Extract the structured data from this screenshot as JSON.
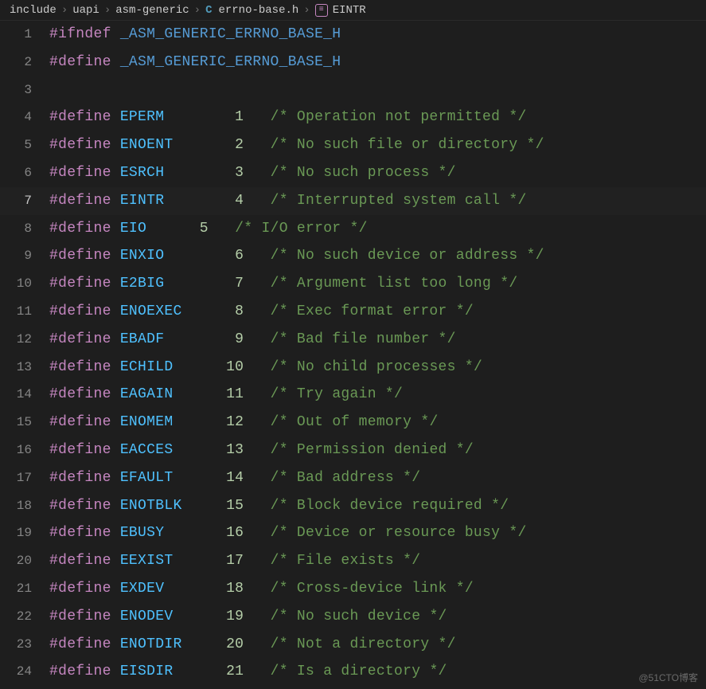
{
  "breadcrumb": {
    "parts": [
      "include",
      "uapi",
      "asm-generic"
    ],
    "file_icon": "C",
    "file": "errno-base.h",
    "symbol_icon": "≡",
    "symbol": "EINTR",
    "sep": "›"
  },
  "watermark": "@51CTO博客",
  "lines": [
    {
      "n": 1,
      "tokens": [
        [
          "directive",
          "#ifndef"
        ],
        [
          "sp",
          " "
        ],
        [
          "macro",
          "_ASM_GENERIC_ERRNO_BASE_H"
        ]
      ]
    },
    {
      "n": 2,
      "tokens": [
        [
          "directive",
          "#define"
        ],
        [
          "sp",
          " "
        ],
        [
          "macro",
          "_ASM_GENERIC_ERRNO_BASE_H"
        ]
      ]
    },
    {
      "n": 3,
      "tokens": []
    },
    {
      "n": 4,
      "tokens": [
        [
          "directive",
          "#define"
        ],
        [
          "sp",
          " "
        ],
        [
          "const",
          "EPERM"
        ],
        [
          "sp",
          "        "
        ],
        [
          "number",
          "1"
        ],
        [
          "sp",
          "   "
        ],
        [
          "comment",
          "/* Operation not permitted */"
        ]
      ]
    },
    {
      "n": 5,
      "tokens": [
        [
          "directive",
          "#define"
        ],
        [
          "sp",
          " "
        ],
        [
          "const",
          "ENOENT"
        ],
        [
          "sp",
          "       "
        ],
        [
          "number",
          "2"
        ],
        [
          "sp",
          "   "
        ],
        [
          "comment",
          "/* No such file or directory */"
        ]
      ]
    },
    {
      "n": 6,
      "tokens": [
        [
          "directive",
          "#define"
        ],
        [
          "sp",
          " "
        ],
        [
          "const",
          "ESRCH"
        ],
        [
          "sp",
          "        "
        ],
        [
          "number",
          "3"
        ],
        [
          "sp",
          "   "
        ],
        [
          "comment",
          "/* No such process */"
        ]
      ]
    },
    {
      "n": 7,
      "current": true,
      "tokens": [
        [
          "directive",
          "#define"
        ],
        [
          "sp",
          " "
        ],
        [
          "const",
          "EINTR"
        ],
        [
          "sp",
          "        "
        ],
        [
          "number",
          "4"
        ],
        [
          "sp",
          "   "
        ],
        [
          "comment",
          "/* Interrupted system call */"
        ]
      ]
    },
    {
      "n": 8,
      "tokens": [
        [
          "directive",
          "#define"
        ],
        [
          "sp",
          " "
        ],
        [
          "const",
          "EIO"
        ],
        [
          "sp",
          "      "
        ],
        [
          "number",
          "5"
        ],
        [
          "sp",
          "   "
        ],
        [
          "comment",
          "/* I/O error */"
        ]
      ]
    },
    {
      "n": 9,
      "tokens": [
        [
          "directive",
          "#define"
        ],
        [
          "sp",
          " "
        ],
        [
          "const",
          "ENXIO"
        ],
        [
          "sp",
          "        "
        ],
        [
          "number",
          "6"
        ],
        [
          "sp",
          "   "
        ],
        [
          "comment",
          "/* No such device or address */"
        ]
      ]
    },
    {
      "n": 10,
      "tokens": [
        [
          "directive",
          "#define"
        ],
        [
          "sp",
          " "
        ],
        [
          "const",
          "E2BIG"
        ],
        [
          "sp",
          "        "
        ],
        [
          "number",
          "7"
        ],
        [
          "sp",
          "   "
        ],
        [
          "comment",
          "/* Argument list too long */"
        ]
      ]
    },
    {
      "n": 11,
      "tokens": [
        [
          "directive",
          "#define"
        ],
        [
          "sp",
          " "
        ],
        [
          "const",
          "ENOEXEC"
        ],
        [
          "sp",
          "      "
        ],
        [
          "number",
          "8"
        ],
        [
          "sp",
          "   "
        ],
        [
          "comment",
          "/* Exec format error */"
        ]
      ]
    },
    {
      "n": 12,
      "tokens": [
        [
          "directive",
          "#define"
        ],
        [
          "sp",
          " "
        ],
        [
          "const",
          "EBADF"
        ],
        [
          "sp",
          "        "
        ],
        [
          "number",
          "9"
        ],
        [
          "sp",
          "   "
        ],
        [
          "comment",
          "/* Bad file number */"
        ]
      ]
    },
    {
      "n": 13,
      "tokens": [
        [
          "directive",
          "#define"
        ],
        [
          "sp",
          " "
        ],
        [
          "const",
          "ECHILD"
        ],
        [
          "sp",
          "      "
        ],
        [
          "number",
          "10"
        ],
        [
          "sp",
          "   "
        ],
        [
          "comment",
          "/* No child processes */"
        ]
      ]
    },
    {
      "n": 14,
      "tokens": [
        [
          "directive",
          "#define"
        ],
        [
          "sp",
          " "
        ],
        [
          "const",
          "EAGAIN"
        ],
        [
          "sp",
          "      "
        ],
        [
          "number",
          "11"
        ],
        [
          "sp",
          "   "
        ],
        [
          "comment",
          "/* Try again */"
        ]
      ]
    },
    {
      "n": 15,
      "tokens": [
        [
          "directive",
          "#define"
        ],
        [
          "sp",
          " "
        ],
        [
          "const",
          "ENOMEM"
        ],
        [
          "sp",
          "      "
        ],
        [
          "number",
          "12"
        ],
        [
          "sp",
          "   "
        ],
        [
          "comment",
          "/* Out of memory */"
        ]
      ]
    },
    {
      "n": 16,
      "tokens": [
        [
          "directive",
          "#define"
        ],
        [
          "sp",
          " "
        ],
        [
          "const",
          "EACCES"
        ],
        [
          "sp",
          "      "
        ],
        [
          "number",
          "13"
        ],
        [
          "sp",
          "   "
        ],
        [
          "comment",
          "/* Permission denied */"
        ]
      ]
    },
    {
      "n": 17,
      "tokens": [
        [
          "directive",
          "#define"
        ],
        [
          "sp",
          " "
        ],
        [
          "const",
          "EFAULT"
        ],
        [
          "sp",
          "      "
        ],
        [
          "number",
          "14"
        ],
        [
          "sp",
          "   "
        ],
        [
          "comment",
          "/* Bad address */"
        ]
      ]
    },
    {
      "n": 18,
      "tokens": [
        [
          "directive",
          "#define"
        ],
        [
          "sp",
          " "
        ],
        [
          "const",
          "ENOTBLK"
        ],
        [
          "sp",
          "     "
        ],
        [
          "number",
          "15"
        ],
        [
          "sp",
          "   "
        ],
        [
          "comment",
          "/* Block device required */"
        ]
      ]
    },
    {
      "n": 19,
      "tokens": [
        [
          "directive",
          "#define"
        ],
        [
          "sp",
          " "
        ],
        [
          "const",
          "EBUSY"
        ],
        [
          "sp",
          "       "
        ],
        [
          "number",
          "16"
        ],
        [
          "sp",
          "   "
        ],
        [
          "comment",
          "/* Device or resource busy */"
        ]
      ]
    },
    {
      "n": 20,
      "tokens": [
        [
          "directive",
          "#define"
        ],
        [
          "sp",
          " "
        ],
        [
          "const",
          "EEXIST"
        ],
        [
          "sp",
          "      "
        ],
        [
          "number",
          "17"
        ],
        [
          "sp",
          "   "
        ],
        [
          "comment",
          "/* File exists */"
        ]
      ]
    },
    {
      "n": 21,
      "tokens": [
        [
          "directive",
          "#define"
        ],
        [
          "sp",
          " "
        ],
        [
          "const",
          "EXDEV"
        ],
        [
          "sp",
          "       "
        ],
        [
          "number",
          "18"
        ],
        [
          "sp",
          "   "
        ],
        [
          "comment",
          "/* Cross-device link */"
        ]
      ]
    },
    {
      "n": 22,
      "tokens": [
        [
          "directive",
          "#define"
        ],
        [
          "sp",
          " "
        ],
        [
          "const",
          "ENODEV"
        ],
        [
          "sp",
          "      "
        ],
        [
          "number",
          "19"
        ],
        [
          "sp",
          "   "
        ],
        [
          "comment",
          "/* No such device */"
        ]
      ]
    },
    {
      "n": 23,
      "tokens": [
        [
          "directive",
          "#define"
        ],
        [
          "sp",
          " "
        ],
        [
          "const",
          "ENOTDIR"
        ],
        [
          "sp",
          "     "
        ],
        [
          "number",
          "20"
        ],
        [
          "sp",
          "   "
        ],
        [
          "comment",
          "/* Not a directory */"
        ]
      ]
    },
    {
      "n": 24,
      "tokens": [
        [
          "directive",
          "#define"
        ],
        [
          "sp",
          " "
        ],
        [
          "const",
          "EISDIR"
        ],
        [
          "sp",
          "      "
        ],
        [
          "number",
          "21"
        ],
        [
          "sp",
          "   "
        ],
        [
          "comment",
          "/* Is a directory */"
        ]
      ]
    }
  ]
}
